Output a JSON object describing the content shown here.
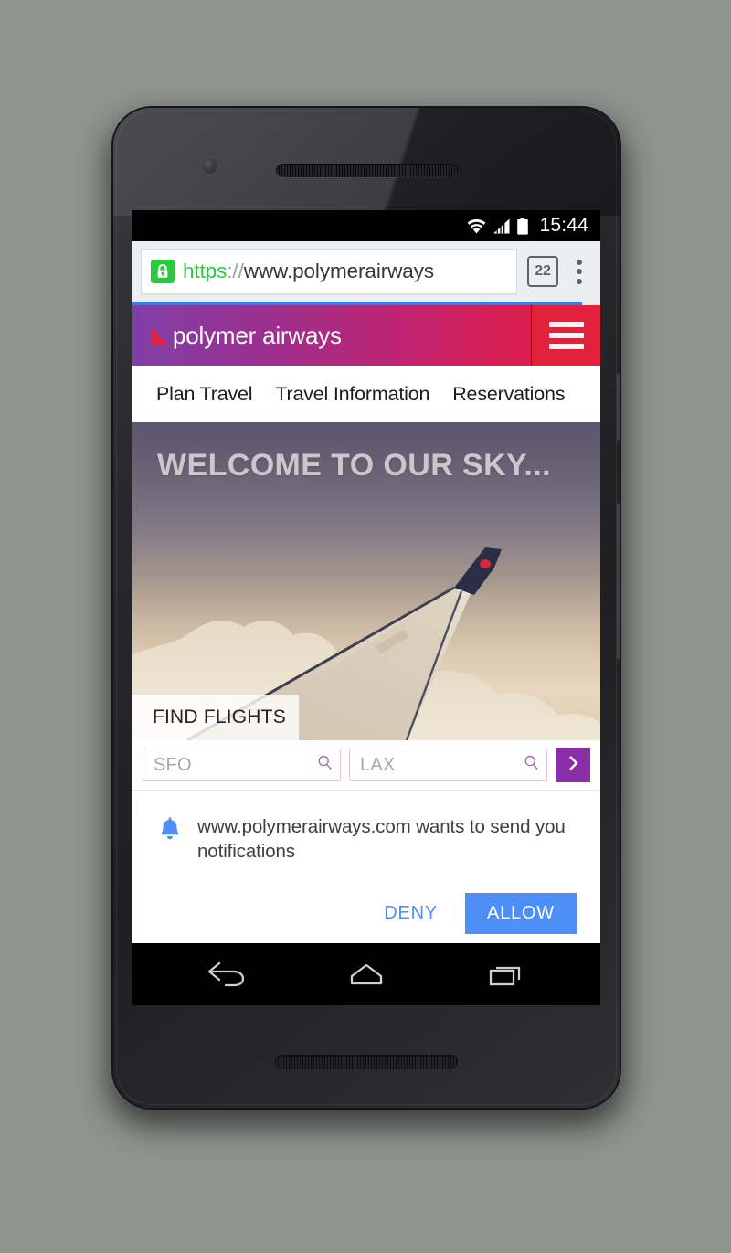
{
  "device": {
    "name": "android-phone",
    "status_bar": {
      "time": "15:44",
      "icons": [
        "wifi-icon",
        "signal-icon",
        "battery-icon"
      ]
    },
    "nav_bar": {
      "back_label": "back-icon",
      "home_label": "home-icon",
      "recents_label": "recents-icon"
    }
  },
  "browser": {
    "security_icon": "lock-icon",
    "url_scheme": "https",
    "url_separator": "://",
    "url_host": "www.polymerairways",
    "tab_count": "22",
    "menu_icon": "overflow-menu-icon",
    "progress_percent": 96
  },
  "site": {
    "brand": "polymer airways",
    "logo_icon": "triangle-logo-icon",
    "menu_icon": "hamburger-icon",
    "nav_items": [
      {
        "label": "Plan Travel"
      },
      {
        "label": "Travel Information"
      },
      {
        "label": "Reservations"
      }
    ],
    "hero": {
      "title": "WELCOME TO OUR SKY...",
      "tab_label": "FIND FLIGHTS"
    },
    "search": {
      "origin_placeholder": "SFO",
      "destination_placeholder": "LAX",
      "origin_value": "",
      "destination_value": "",
      "search_icon": "search-icon",
      "submit_icon": "chevron-right-icon"
    }
  },
  "permission_dialog": {
    "icon": "bell-icon",
    "message": "www.polymerairways.com wants to send you notifications",
    "deny_label": "DENY",
    "allow_label": "ALLOW"
  },
  "colors": {
    "header_gradient_start": "#7f3fa6",
    "header_gradient_end": "#e31f3c",
    "hamburger_red": "#e3213b",
    "purple_button": "#8b2fa8",
    "allow_blue": "#4e8ef7",
    "lock_green": "#2aca3e",
    "progress_blue": "#2d7ff0"
  }
}
